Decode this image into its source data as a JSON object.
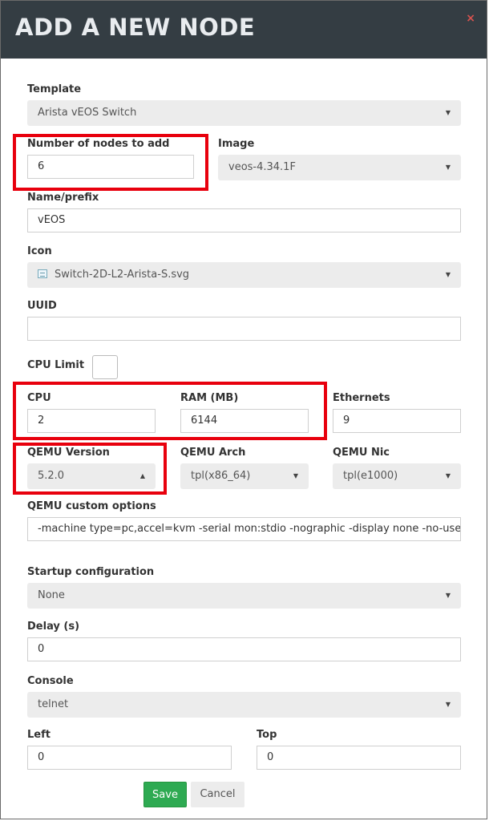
{
  "dialog": {
    "title": "ADD A NEW NODE",
    "close_glyph": "×"
  },
  "template": {
    "label": "Template",
    "value": "Arista vEOS Switch"
  },
  "nodes_count": {
    "label": "Number of nodes to add",
    "value": "6"
  },
  "image": {
    "label": "Image",
    "value": "veos-4.34.1F"
  },
  "name_prefix": {
    "label": "Name/prefix",
    "value": "vEOS"
  },
  "icon": {
    "label": "Icon",
    "value": "Switch-2D-L2-Arista-S.svg",
    "icon_name": "image-file-icon"
  },
  "uuid": {
    "label": "UUID",
    "value": ""
  },
  "cpu_limit": {
    "label": "CPU Limit",
    "checked": false
  },
  "cpu": {
    "label": "CPU",
    "value": "2"
  },
  "ram": {
    "label": "RAM (MB)",
    "value": "6144"
  },
  "ethernets": {
    "label": "Ethernets",
    "value": "9"
  },
  "qemu_version": {
    "label": "QEMU Version",
    "value": "5.2.0"
  },
  "qemu_arch": {
    "label": "QEMU Arch",
    "value": "tpl(x86_64)"
  },
  "qemu_nic": {
    "label": "QEMU Nic",
    "value": "tpl(e1000)"
  },
  "qemu_options": {
    "label": "QEMU custom options",
    "value": "-machine type=pc,accel=kvm -serial mon:stdio -nographic -display none -no-user-config"
  },
  "startup_config": {
    "label": "Startup configuration",
    "value": "None"
  },
  "delay": {
    "label": "Delay (s)",
    "value": "0"
  },
  "console": {
    "label": "Console",
    "value": "telnet"
  },
  "left": {
    "label": "Left",
    "value": "0"
  },
  "top": {
    "label": "Top",
    "value": "0"
  },
  "buttons": {
    "save": "Save",
    "cancel": "Cancel"
  },
  "glyphs": {
    "caret_down": "▼",
    "caret_up": "▲"
  },
  "colors": {
    "header_bg": "#343d43",
    "highlight": "#e8000d",
    "save_bg": "#2eaa52",
    "close": "#d9534f"
  }
}
